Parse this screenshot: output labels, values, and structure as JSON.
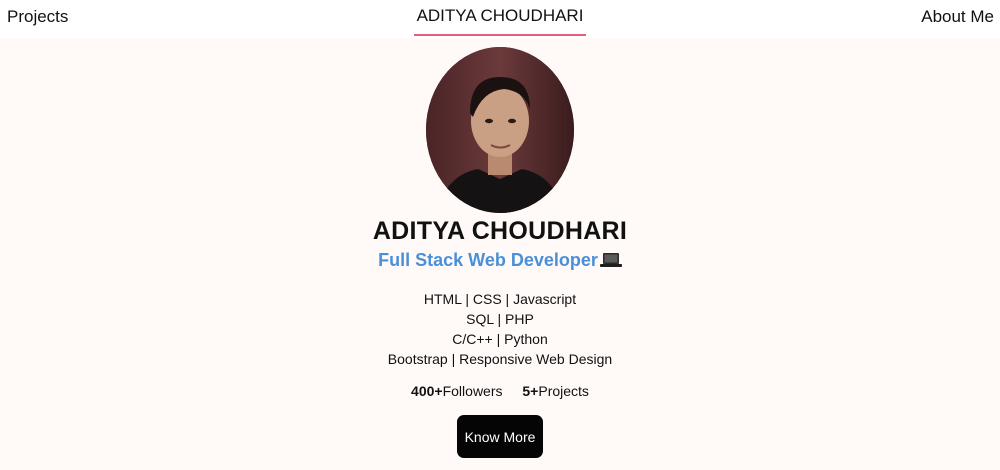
{
  "nav": {
    "left_link": "Projects",
    "brand": "ADITYA CHOUDHARI",
    "right_link": "About Me"
  },
  "profile": {
    "name": "ADITYA CHOUDHARI",
    "role": "Full Stack Web Developer",
    "role_icon": "laptop-icon",
    "skills": [
      "HTML | CSS | Javascript",
      "SQL | PHP",
      "C/C++ | Python",
      "Bootstrap | Responsive Web Design"
    ],
    "stats": [
      {
        "value": "400+",
        "label": "Followers"
      },
      {
        "value": "5+",
        "label": "Projects"
      }
    ],
    "button_label": "Know More"
  },
  "colors": {
    "accent_underline": "#e0607a",
    "role_blue": "#4a90d9",
    "page_background": "#fff9f7",
    "button_background": "#050505"
  }
}
